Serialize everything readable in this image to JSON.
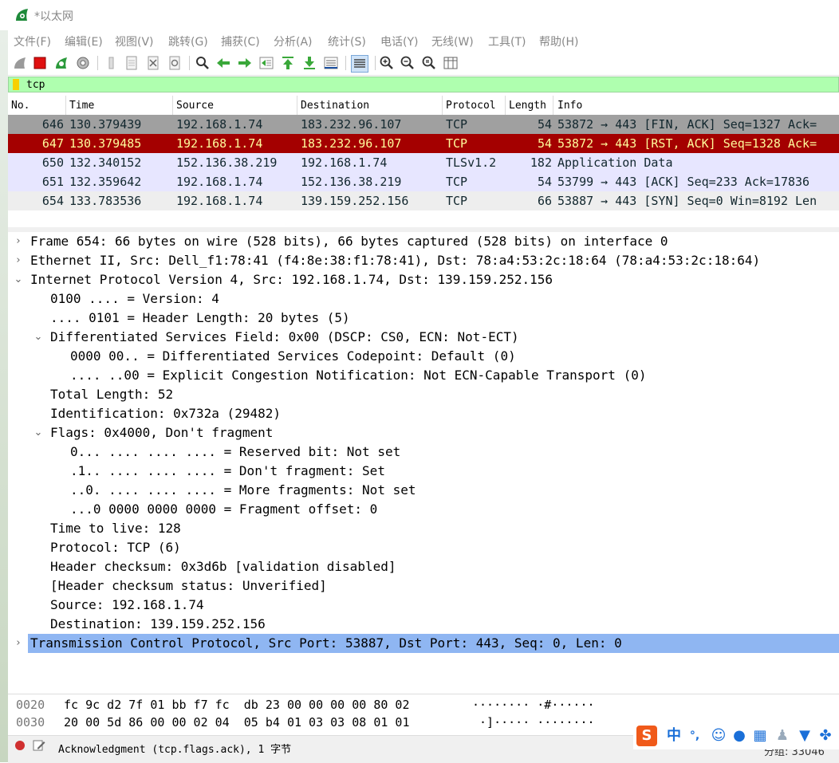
{
  "window": {
    "title": "*以太网"
  },
  "menu": [
    "文件(F)",
    "编辑(E)",
    "视图(V)",
    "跳转(G)",
    "捕获(C)",
    "分析(A)",
    "统计(S)",
    "电话(Y)",
    "无线(W)",
    "工具(T)",
    "帮助(H)"
  ],
  "toolbar_icons": [
    "shark-fin-start-icon",
    "stop-capture-icon",
    "restart-capture-icon",
    "capture-options-icon",
    "open-file-icon",
    "save-file-icon",
    "close-file-icon",
    "reload-file-icon",
    "find-packet-icon",
    "go-back-icon",
    "go-forward-icon",
    "go-to-packet-icon",
    "first-packet-icon",
    "last-packet-icon",
    "autoscroll-icon",
    "colorize-icon",
    "zoom-in-icon",
    "zoom-out-icon",
    "zoom-normal-icon",
    "resize-columns-icon"
  ],
  "filter": {
    "value": "tcp"
  },
  "packet_list": {
    "columns": [
      "No.",
      "Time",
      "Source",
      "Destination",
      "Protocol",
      "Length",
      "Info"
    ],
    "rows": [
      {
        "no": "646",
        "time": "130.379439",
        "src": "192.168.1.74",
        "dst": "183.232.96.107",
        "proto": "TCP",
        "len": "54",
        "info": "53872 → 443 [FIN, ACK] Seq=1327 Ack=",
        "bg": "#a0a0a0",
        "fg": "#12272e"
      },
      {
        "no": "647",
        "time": "130.379485",
        "src": "192.168.1.74",
        "dst": "183.232.96.107",
        "proto": "TCP",
        "len": "54",
        "info": "53872 → 443 [RST, ACK] Seq=1328 Ack=",
        "bg": "#a40000",
        "fg": "#fffc9c"
      },
      {
        "no": "650",
        "time": "132.340152",
        "src": "152.136.38.219",
        "dst": "192.168.1.74",
        "proto": "TLSv1.2",
        "len": "182",
        "info": "Application Data",
        "bg": "#e7e6ff",
        "fg": "#12272e"
      },
      {
        "no": "651",
        "time": "132.359642",
        "src": "192.168.1.74",
        "dst": "152.136.38.219",
        "proto": "TCP",
        "len": "54",
        "info": "53799 → 443 [ACK] Seq=233 Ack=17836",
        "bg": "#e7e6ff",
        "fg": "#12272e"
      },
      {
        "no": "654",
        "time": "133.783536",
        "src": "192.168.1.74",
        "dst": "139.159.252.156",
        "proto": "TCP",
        "len": "66",
        "info": "53887 → 443 [SYN] Seq=0 Win=8192 Len",
        "bg": "#eeeeee",
        "fg": "#12272e"
      }
    ]
  },
  "details": [
    {
      "indent": 0,
      "arrow": ">",
      "text": "Frame 654: 66 bytes on wire (528 bits), 66 bytes captured (528 bits) on interface 0"
    },
    {
      "indent": 0,
      "arrow": ">",
      "text": "Ethernet II, Src: Dell_f1:78:41 (f4:8e:38:f1:78:41), Dst: 78:a4:53:2c:18:64 (78:a4:53:2c:18:64)"
    },
    {
      "indent": 0,
      "arrow": "v",
      "text": "Internet Protocol Version 4, Src: 192.168.1.74, Dst: 139.159.252.156"
    },
    {
      "indent": 1,
      "arrow": "",
      "text": "0100 .... = Version: 4"
    },
    {
      "indent": 1,
      "arrow": "",
      "text": ".... 0101 = Header Length: 20 bytes (5)"
    },
    {
      "indent": 1,
      "arrow": "v",
      "text": "Differentiated Services Field: 0x00 (DSCP: CS0, ECN: Not-ECT)"
    },
    {
      "indent": 2,
      "arrow": "",
      "text": "0000 00.. = Differentiated Services Codepoint: Default (0)"
    },
    {
      "indent": 2,
      "arrow": "",
      "text": ".... ..00 = Explicit Congestion Notification: Not ECN-Capable Transport (0)"
    },
    {
      "indent": 1,
      "arrow": "",
      "text": "Total Length: 52"
    },
    {
      "indent": 1,
      "arrow": "",
      "text": "Identification: 0x732a (29482)"
    },
    {
      "indent": 1,
      "arrow": "v",
      "text": "Flags: 0x4000, Don't fragment"
    },
    {
      "indent": 2,
      "arrow": "",
      "text": "0... .... .... .... = Reserved bit: Not set"
    },
    {
      "indent": 2,
      "arrow": "",
      "text": ".1.. .... .... .... = Don't fragment: Set"
    },
    {
      "indent": 2,
      "arrow": "",
      "text": "..0. .... .... .... = More fragments: Not set"
    },
    {
      "indent": 2,
      "arrow": "",
      "text": "...0 0000 0000 0000 = Fragment offset: 0"
    },
    {
      "indent": 1,
      "arrow": "",
      "text": "Time to live: 128"
    },
    {
      "indent": 1,
      "arrow": "",
      "text": "Protocol: TCP (6)"
    },
    {
      "indent": 1,
      "arrow": "",
      "text": "Header checksum: 0x3d6b [validation disabled]"
    },
    {
      "indent": 1,
      "arrow": "",
      "text": "[Header checksum status: Unverified]"
    },
    {
      "indent": 1,
      "arrow": "",
      "text": "Source: 192.168.1.74"
    },
    {
      "indent": 1,
      "arrow": "",
      "text": "Destination: 139.159.252.156"
    },
    {
      "indent": 0,
      "arrow": ">",
      "text": "Transmission Control Protocol, Src Port: 53887, Dst Port: 443, Seq: 0, Len: 0",
      "selected": true
    }
  ],
  "hex": [
    {
      "offset": "0020",
      "bytes": "fc 9c d2 7f 01 bb f7 fc  db 23 00 00 00 00 80 02",
      "ascii": "········ ·#······"
    },
    {
      "offset": "0030",
      "bytes": "20 00 5d 86 00 00 02 04  05 b4 01 03 03 08 01 01",
      "ascii": " ·]····· ········"
    }
  ],
  "status": {
    "text": "Acknowledgment (tcp.flags.ack), 1 字节",
    "count": "分组: 33046"
  },
  "ime": {
    "lang": "中",
    "punct": "°,"
  },
  "colors": {
    "selected": "#8fb6f2",
    "filter_ok": "#afffaf"
  }
}
